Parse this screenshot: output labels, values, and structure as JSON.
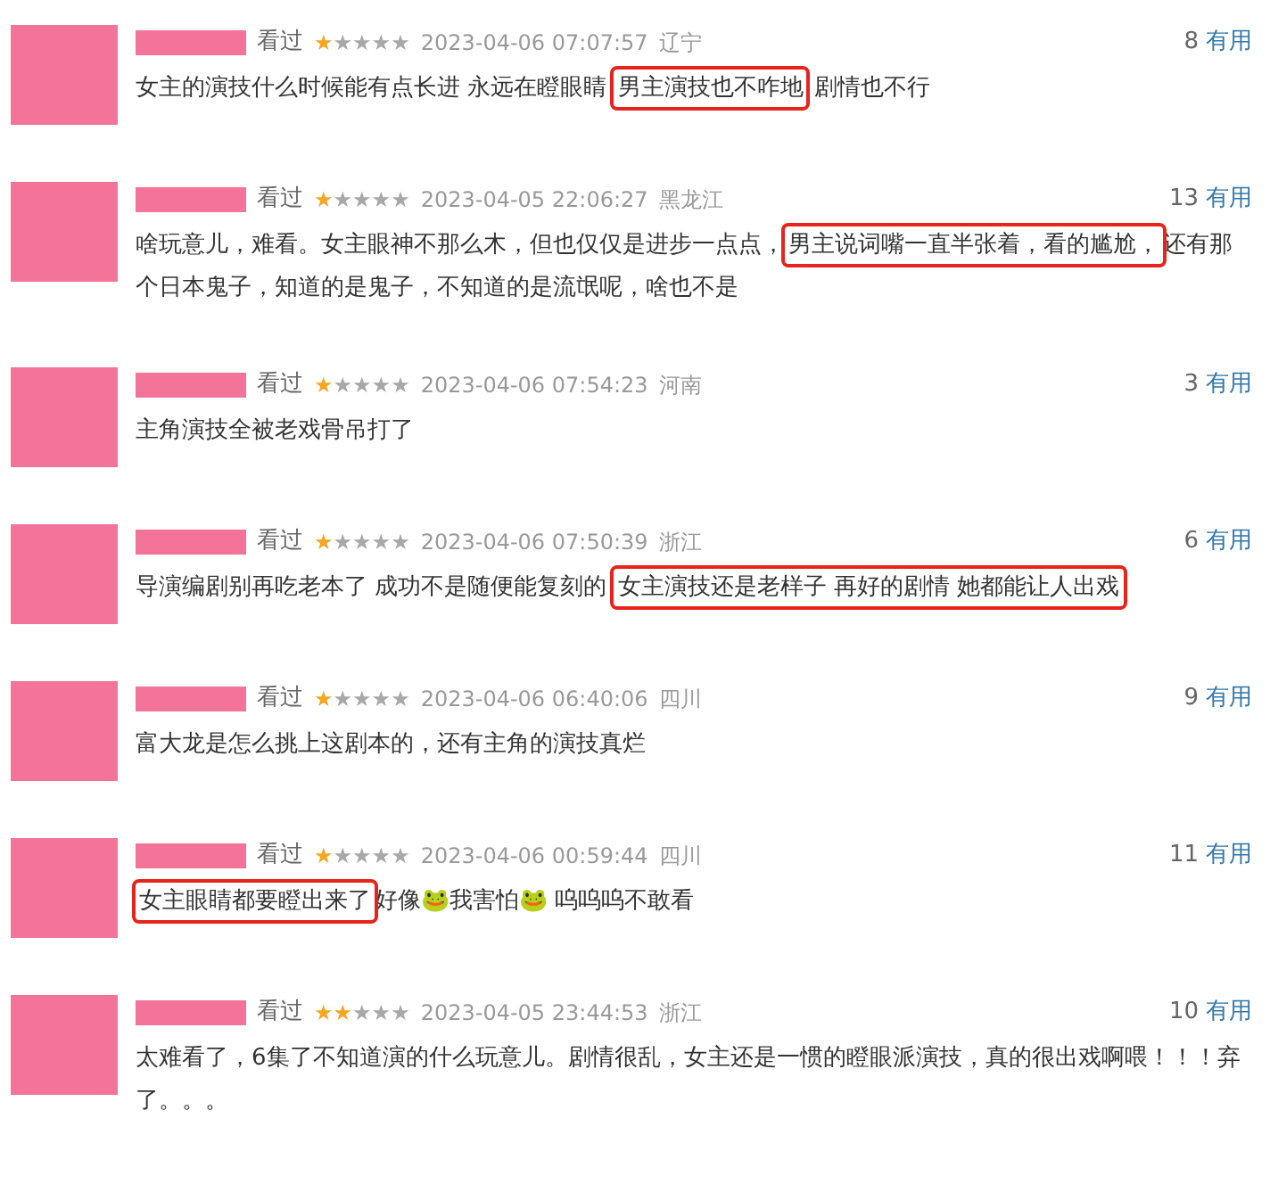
{
  "comments": [
    {
      "status": "看过",
      "stars": 1,
      "time": "2023-04-06 07:07:57",
      "location": "辽宁",
      "votes": "8",
      "vote_label": "有用",
      "segments": [
        {
          "text": "女主的演技什么时候能有点长进 永远在瞪眼睛 ",
          "highlighted": false
        },
        {
          "text": "男主演技也不咋地",
          "highlighted": true
        },
        {
          "text": " 剧情也不行",
          "highlighted": false
        }
      ]
    },
    {
      "status": "看过",
      "stars": 1,
      "time": "2023-04-05 22:06:27",
      "location": "黑龙江",
      "votes": "13",
      "vote_label": "有用",
      "segments": [
        {
          "text": "啥玩意儿，难看。女主眼神不那么木，但也仅仅是进步一点点，",
          "highlighted": false
        },
        {
          "text": "男主说词嘴一直半张着，看的尴尬，",
          "highlighted": true
        },
        {
          "text": "还有那个日本鬼子，知道的是鬼子，不知道的是流氓呢，啥也不是",
          "highlighted": false
        }
      ]
    },
    {
      "status": "看过",
      "stars": 1,
      "time": "2023-04-06 07:54:23",
      "location": "河南",
      "votes": "3",
      "vote_label": "有用",
      "segments": [
        {
          "text": "主角演技全被老戏骨吊打了",
          "highlighted": false
        }
      ]
    },
    {
      "status": "看过",
      "stars": 1,
      "time": "2023-04-06 07:50:39",
      "location": "浙江",
      "votes": "6",
      "vote_label": "有用",
      "segments": [
        {
          "text": "导演编剧别再吃老本了 成功不是随便能复刻的 ",
          "highlighted": false
        },
        {
          "text": "女主演技还是老样子 再好的剧情 她都能让人出戏",
          "highlighted": true
        }
      ]
    },
    {
      "status": "看过",
      "stars": 1,
      "time": "2023-04-06 06:40:06",
      "location": "四川",
      "votes": "9",
      "vote_label": "有用",
      "segments": [
        {
          "text": "富大龙是怎么挑上这剧本的，还有主角的演技真烂",
          "highlighted": false
        }
      ]
    },
    {
      "status": "看过",
      "stars": 1,
      "time": "2023-04-06 00:59:44",
      "location": "四川",
      "votes": "11",
      "vote_label": "有用",
      "segments": [
        {
          "text": "女主眼睛都要瞪出来了",
          "highlighted": true
        },
        {
          "text": "好像🐸我害怕🐸 呜呜呜不敢看",
          "highlighted": false
        }
      ]
    },
    {
      "status": "看过",
      "stars": 2,
      "time": "2023-04-05 23:44:53",
      "location": "浙江",
      "votes": "10",
      "vote_label": "有用",
      "segments": [
        {
          "text": "太难看了，6集了不知道演的什么玩意儿。剧情很乱，女主还是一惯的瞪眼派演技，真的很出戏啊喂！！！弃了。。。",
          "highlighted": false
        }
      ]
    }
  ]
}
